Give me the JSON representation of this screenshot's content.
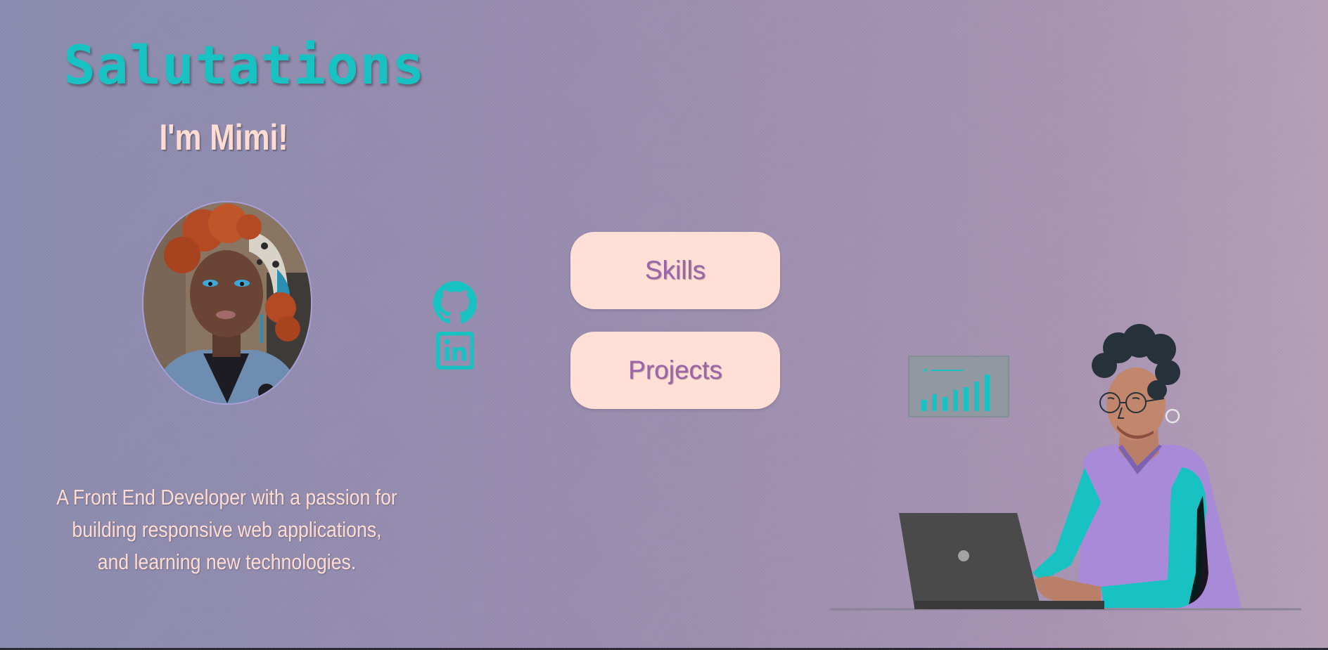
{
  "hero": {
    "title": "Salutations",
    "subtitle": "I'm Mimi!",
    "bio": "A Front End Developer with a passion for building responsive web applications, and learning new technologies."
  },
  "social": {
    "github_icon": "github-icon",
    "linkedin_icon": "linkedin-icon"
  },
  "nav": {
    "skills_label": "Skills",
    "projects_label": "Projects"
  },
  "colors": {
    "accent_teal": "#19c2c2",
    "peach": "#ffdcd2",
    "button_text": "#9e63ab",
    "button_bg": "#ffdfd6"
  }
}
